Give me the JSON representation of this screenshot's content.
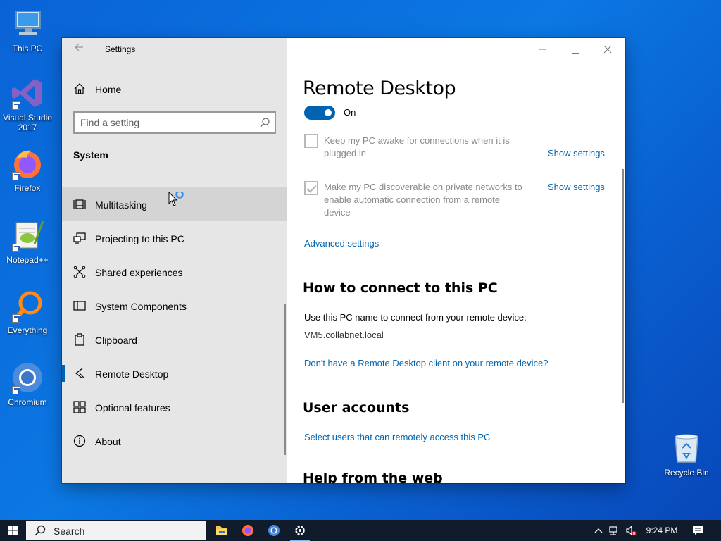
{
  "desktop": {
    "icons": [
      {
        "label": "This PC",
        "icon": "computer-icon"
      },
      {
        "label": "Visual Studio 2017",
        "icon": "visual-studio-icon"
      },
      {
        "label": "Firefox",
        "icon": "firefox-icon"
      },
      {
        "label": "Notepad++",
        "icon": "notepadpp-icon"
      },
      {
        "label": "Everything",
        "icon": "everything-search-icon"
      },
      {
        "label": "Chromium",
        "icon": "chromium-icon"
      },
      {
        "label": "Recycle Bin",
        "icon": "recycle-bin-icon"
      }
    ]
  },
  "window": {
    "title": "Settings",
    "nav": {
      "home_label": "Home",
      "search_placeholder": "Find a setting",
      "section_label": "System",
      "items": [
        {
          "label": "Multitasking",
          "icon": "multitasking-icon",
          "state": "hover"
        },
        {
          "label": "Projecting to this PC",
          "icon": "projecting-icon"
        },
        {
          "label": "Shared experiences",
          "icon": "shared-experiences-icon"
        },
        {
          "label": "System Components",
          "icon": "system-components-icon"
        },
        {
          "label": "Clipboard",
          "icon": "clipboard-icon"
        },
        {
          "label": "Remote Desktop",
          "icon": "remote-desktop-icon",
          "state": "selected"
        },
        {
          "label": "Optional features",
          "icon": "optional-features-icon"
        },
        {
          "label": "About",
          "icon": "info-icon"
        }
      ]
    },
    "content": {
      "title": "Remote Desktop",
      "toggle_state": "On",
      "keep_awake": {
        "text_line1": "Keep my PC awake for connections when it is",
        "text_line2": "plugged in",
        "checked": false,
        "link": "Show settings"
      },
      "discoverable": {
        "text_line1": "Make my PC discoverable on private networks to",
        "text_line2": "enable automatic connection from a remote",
        "text_line3": "device",
        "checked": true,
        "link": "Show settings"
      },
      "advanced_link": "Advanced settings",
      "how_to_connect": {
        "heading": "How to connect to this PC",
        "instruction": "Use this PC name to connect from your remote device:",
        "pc_name": "VM5.collabnet.local",
        "client_link": "Don't have a Remote Desktop client on your remote device?"
      },
      "user_accounts": {
        "heading": "User accounts",
        "link": "Select users that can remotely access this PC"
      },
      "help_heading": "Help from the web"
    }
  },
  "taskbar": {
    "search_label": "Search",
    "apps": [
      "file-explorer-icon",
      "firefox-icon",
      "chromium-icon",
      "settings-gear-icon"
    ],
    "clock": "9:24 PM"
  },
  "colors": {
    "accent": "#0063b1",
    "link": "#0066b4",
    "nav_bg": "#e6e6e6",
    "taskbar_bg": "#101c2c"
  }
}
